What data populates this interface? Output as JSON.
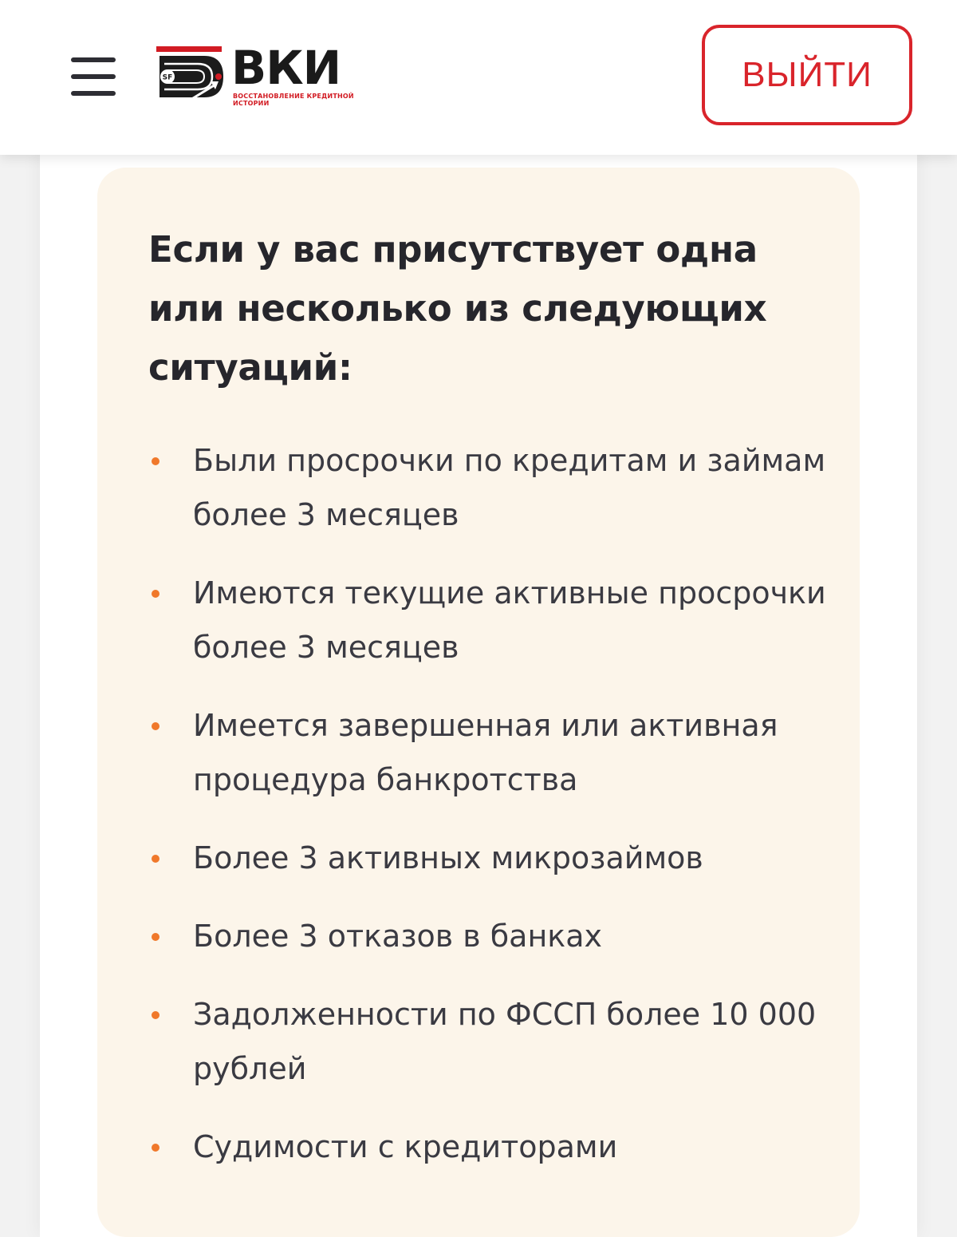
{
  "header": {
    "logo": {
      "wordmark": "ВКИ",
      "subtitle": "ВОССТАНОВЛЕНИЕ КРЕДИТНОЙ ИСТОРИИ",
      "mark_text": "SF"
    },
    "logout_label": "ВЫЙТИ"
  },
  "colors": {
    "accent": "#d9242b",
    "bullet": "#f0782a",
    "card_background": "#fcf5ea",
    "text": "#26262c"
  },
  "card": {
    "title": "Если у вас присутствует одна или несколько из следующих ситуаций:",
    "items": [
      {
        "text": "Были просрочки по кредитам и займам более 3 месяцев"
      },
      {
        "text": "Имеются текущие активные просрочки более 3 месяцев"
      },
      {
        "text": "Имеется завершенная или активная процедура банкротства"
      },
      {
        "text": "Более 3 активных микрозаймов"
      },
      {
        "text": "Более 3 отказов в банках"
      },
      {
        "text": "Задолженности по ФССП более 10 000 рублей"
      },
      {
        "text": "Судимости с кредиторами"
      }
    ]
  }
}
